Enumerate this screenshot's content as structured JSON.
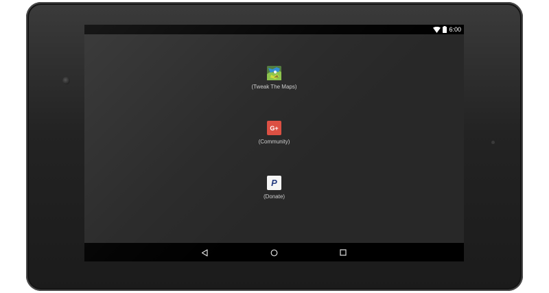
{
  "status_bar": {
    "time": "6:00",
    "icons": [
      "wifi-icon",
      "battery-icon"
    ]
  },
  "apps": [
    {
      "label": "(Tweak The Maps)",
      "icon": "tweak-the-maps-icon"
    },
    {
      "label": "(Community)",
      "icon": "google-plus-icon",
      "icon_text": "G+",
      "color": "#dc4e41"
    },
    {
      "label": "(Donate)",
      "icon": "paypal-icon",
      "icon_text": "P",
      "color": "#253b80"
    }
  ],
  "nav_bar": {
    "buttons": [
      "back-icon",
      "home-icon",
      "recents-icon"
    ]
  },
  "colors": {
    "screen_bg": "#282828",
    "bars": "#000000",
    "bezel": "#232323"
  }
}
